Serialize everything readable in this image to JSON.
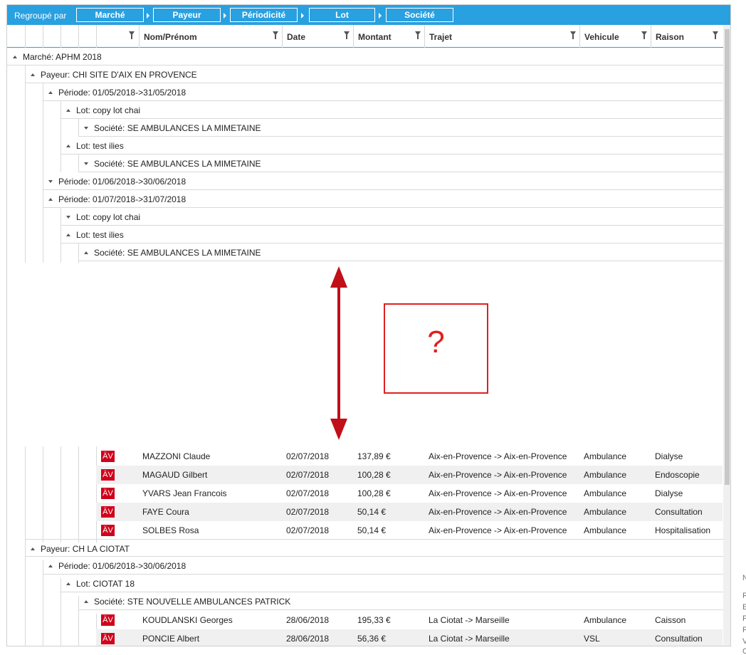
{
  "groupbar": {
    "label": "Regroupé par",
    "chips": [
      "Marché",
      "Payeur",
      "Périodicité",
      "Lot",
      "Société"
    ]
  },
  "columns": [
    "Nom/Prénom",
    "Date",
    "Montant",
    "Trajet",
    "Vehicule",
    "Raison"
  ],
  "groups_top": [
    {
      "level": 0,
      "dir": "up",
      "text": "Marché: APHM 2018"
    },
    {
      "level": 1,
      "dir": "up",
      "text": "Payeur: CHI SITE D'AIX EN PROVENCE"
    },
    {
      "level": 2,
      "dir": "up",
      "text": "Période: 01/05/2018->31/05/2018"
    },
    {
      "level": 3,
      "dir": "up",
      "text": "Lot: copy lot chai"
    },
    {
      "level": 4,
      "dir": "down",
      "text": "Société: SE AMBULANCES LA MIMETAINE"
    },
    {
      "level": 3,
      "dir": "up",
      "text": "Lot: test ilies"
    },
    {
      "level": 4,
      "dir": "down",
      "text": "Société: SE AMBULANCES LA MIMETAINE"
    },
    {
      "level": 2,
      "dir": "down",
      "text": "Période: 01/06/2018->30/06/2018"
    },
    {
      "level": 2,
      "dir": "up",
      "text": "Période: 01/07/2018->31/07/2018"
    },
    {
      "level": 3,
      "dir": "down",
      "text": "Lot: copy lot chai"
    },
    {
      "level": 3,
      "dir": "up",
      "text": "Lot: test ilies"
    },
    {
      "level": 4,
      "dir": "up",
      "text": "Société: SE AMBULANCES LA MIMETAINE"
    }
  ],
  "overlay": {
    "question": "?"
  },
  "rows_a": [
    {
      "badge": "ÄV",
      "name": "MAZZONI Claude",
      "date": "02/07/2018",
      "amount": "137,89 €",
      "trajet": "Aix-en-Provence -> Aix-en-Provence",
      "vehicule": "Ambulance",
      "raison": "Dialyse"
    },
    {
      "badge": "ÄV",
      "name": "MAGAUD Gilbert",
      "date": "02/07/2018",
      "amount": "100,28 €",
      "trajet": "Aix-en-Provence -> Aix-en-Provence",
      "vehicule": "Ambulance",
      "raison": "Endoscopie"
    },
    {
      "badge": "ÄV",
      "name": "YVARS  Jean Francois",
      "date": "02/07/2018",
      "amount": "100,28 €",
      "trajet": "Aix-en-Provence -> Aix-en-Provence",
      "vehicule": "Ambulance",
      "raison": "Dialyse"
    },
    {
      "badge": "ÄV",
      "name": "FAYE Coura",
      "date": "02/07/2018",
      "amount": "50,14 €",
      "trajet": "Aix-en-Provence -> Aix-en-Provence",
      "vehicule": "Ambulance",
      "raison": "Consultation"
    },
    {
      "badge": "ÄV",
      "name": "SOLBES Rosa",
      "date": "02/07/2018",
      "amount": "50,14 €",
      "trajet": "Aix-en-Provence -> Aix-en-Provence",
      "vehicule": "Ambulance",
      "raison": "Hospitalisation"
    }
  ],
  "groups_bottom": [
    {
      "level": 1,
      "dir": "up",
      "text": "Payeur: CH LA CIOTAT"
    },
    {
      "level": 2,
      "dir": "up",
      "text": "Période: 01/06/2018->30/06/2018"
    },
    {
      "level": 3,
      "dir": "up",
      "text": "Lot: CIOTAT 18"
    },
    {
      "level": 4,
      "dir": "up",
      "text": "Société: STE NOUVELLE AMBULANCES PATRICK"
    }
  ],
  "rows_b": [
    {
      "badge": "ÄV",
      "name": "KOUDLANSKI Georges",
      "date": "28/06/2018",
      "amount": "195,33 €",
      "trajet": "La Ciotat -> Marseille",
      "vehicule": "Ambulance",
      "raison": "Caisson"
    },
    {
      "badge": "ÄV",
      "name": "PONCIE Albert",
      "date": "28/06/2018",
      "amount": "56,36 €",
      "trajet": "La Ciotat -> Marseille",
      "vehicule": "VSL",
      "raison": "Consultation"
    }
  ],
  "sidebar_fragments": [
    "N",
    "R",
    "E",
    "P",
    "F",
    "V",
    "C"
  ]
}
